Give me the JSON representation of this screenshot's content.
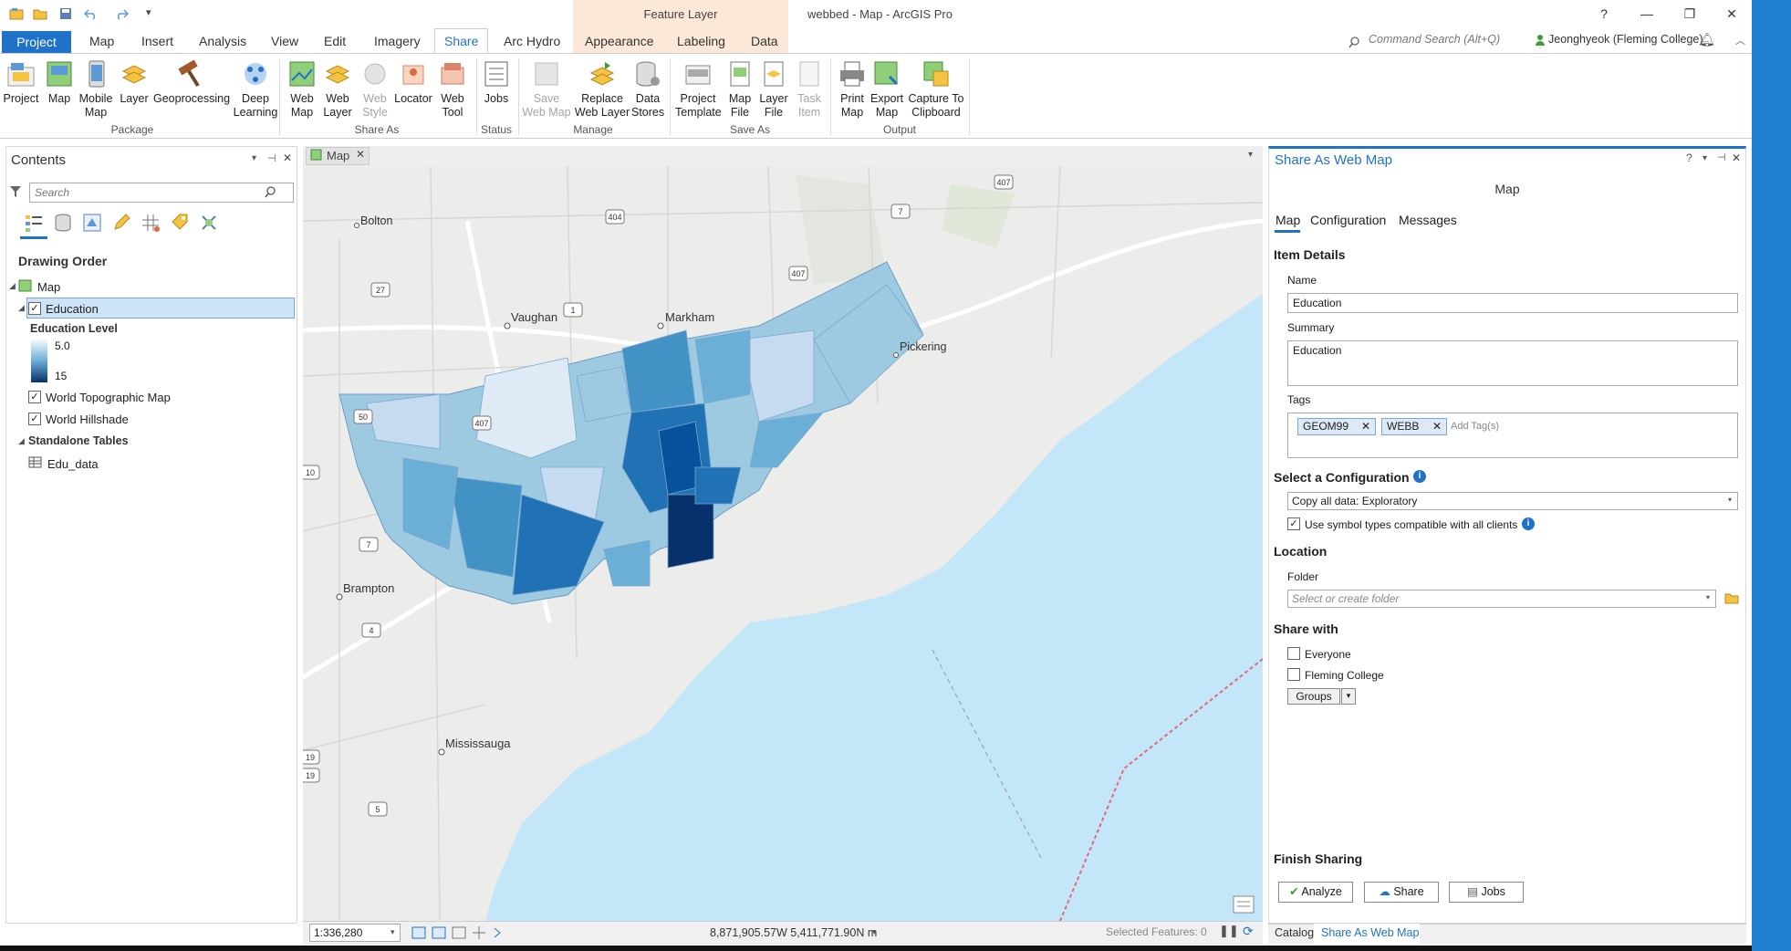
{
  "app": {
    "title": "webbed - Map - ArcGIS Pro",
    "context_tab_group": "Feature Layer",
    "help": "?",
    "command_search_placeholder": "Command Search (Alt+Q)",
    "user": "Jeonghyeok (Fleming College)"
  },
  "tabs": [
    {
      "label": "Project"
    },
    {
      "label": "Map"
    },
    {
      "label": "Insert"
    },
    {
      "label": "Analysis"
    },
    {
      "label": "View"
    },
    {
      "label": "Edit"
    },
    {
      "label": "Imagery"
    },
    {
      "label": "Share"
    },
    {
      "label": "Arc Hydro"
    },
    {
      "label": "Appearance"
    },
    {
      "label": "Labeling"
    },
    {
      "label": "Data"
    }
  ],
  "ribbon": {
    "package": {
      "label": "Package",
      "buttons": [
        "Project",
        "Map",
        "Mobile Map",
        "Layer",
        "Geoprocessing",
        "Deep Learning"
      ]
    },
    "share_as": {
      "label": "Share As",
      "buttons": [
        "Web Map",
        "Web Layer",
        "Web Style",
        "Locator",
        "Web Tool"
      ]
    },
    "status": {
      "label": "Status",
      "buttons": [
        "Jobs"
      ]
    },
    "manage": {
      "label": "Manage",
      "buttons": [
        "Save Web Map",
        "Replace Web Layer",
        "Data Stores"
      ]
    },
    "save_as": {
      "label": "Save As",
      "buttons": [
        "Project Template",
        "Map File",
        "Layer File",
        "Task Item"
      ]
    },
    "output": {
      "label": "Output",
      "buttons": [
        "Print Map",
        "Export Map",
        "Capture To Clipboard"
      ]
    }
  },
  "contents": {
    "title": "Contents",
    "search_placeholder": "Search",
    "drawing_order": "Drawing Order",
    "map": "Map",
    "layer_education": "Education",
    "legend_title": "Education Level",
    "legend_min": "5.0",
    "legend_max": "15",
    "layer_topo": "World Topographic Map",
    "layer_hillshade": "World Hillshade",
    "standalone_tables": "Standalone Tables",
    "table_edu": "Edu_data"
  },
  "map_view": {
    "tab": "Map",
    "places": [
      "Bolton",
      "Vaughan",
      "Markham",
      "Pickering",
      "Brampton",
      "Mississauga"
    ],
    "shields": [
      "407",
      "404",
      "7",
      "27",
      "1",
      "407",
      "50",
      "407",
      "10",
      "7",
      "4",
      "19",
      "19",
      "5"
    ],
    "scale": "1:336,280",
    "coords": "8,871,905.57W 5,411,771.90N m",
    "selected_features": "Selected Features: 0"
  },
  "share": {
    "title": "Share As Web Map",
    "subtitle": "Map",
    "tabs": [
      "Map",
      "Configuration",
      "Messages"
    ],
    "item_details": "Item Details",
    "name_label": "Name",
    "name_value": "Education",
    "summary_label": "Summary",
    "summary_value": "Education",
    "tags_label": "Tags",
    "tags": [
      "GEOM99",
      "WEBB"
    ],
    "add_tag_placeholder": "Add Tag(s)",
    "select_config": "Select a Configuration",
    "config_value": "Copy all data: Exploratory",
    "compat_label": "Use symbol types compatible with all clients",
    "location": "Location",
    "folder_label": "Folder",
    "folder_placeholder": "Select or create folder",
    "share_with": "Share with",
    "everyone": "Everyone",
    "fleming": "Fleming College",
    "groups": "Groups",
    "finish_sharing": "Finish Sharing",
    "analyze": "Analyze",
    "share_btn": "Share",
    "jobs_btn": "Jobs"
  },
  "bottom_tabs": [
    "Catalog",
    "Share As Web Map"
  ],
  "colors": {
    "accent": "#1e73c8",
    "water": "#c3e6f8",
    "land": "#ececea",
    "choropleth_dark": "#08306b"
  }
}
